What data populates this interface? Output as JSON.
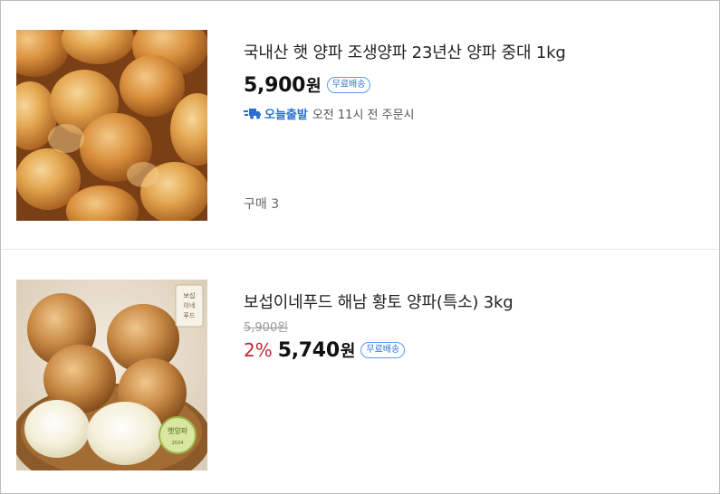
{
  "products": [
    {
      "title": "국내산 햇 양파 조생양파 23년산 양파 중대 1kg",
      "price": "5,900",
      "currency": "원",
      "badge": "무료배송",
      "ship_label": "오늘출발",
      "ship_text": "오전 11시 전 주문시",
      "purchase_count": "구매 3",
      "image_icon": "onion-pile-image"
    },
    {
      "title": "보섭이네푸드 해남 황토 양파(특소) 3kg",
      "original_price": "5,900원",
      "discount": "2%",
      "price": "5,740",
      "currency": "원",
      "badge": "무료배송",
      "image_text_brand": "보섭이네푸드",
      "image_text_stamp": "햇양파",
      "image_icon": "onion-basket-image"
    }
  ],
  "colors": {
    "accent_blue": "#2a6fd6",
    "discount_red": "#c0262d",
    "divider": "#e6e6e6"
  }
}
